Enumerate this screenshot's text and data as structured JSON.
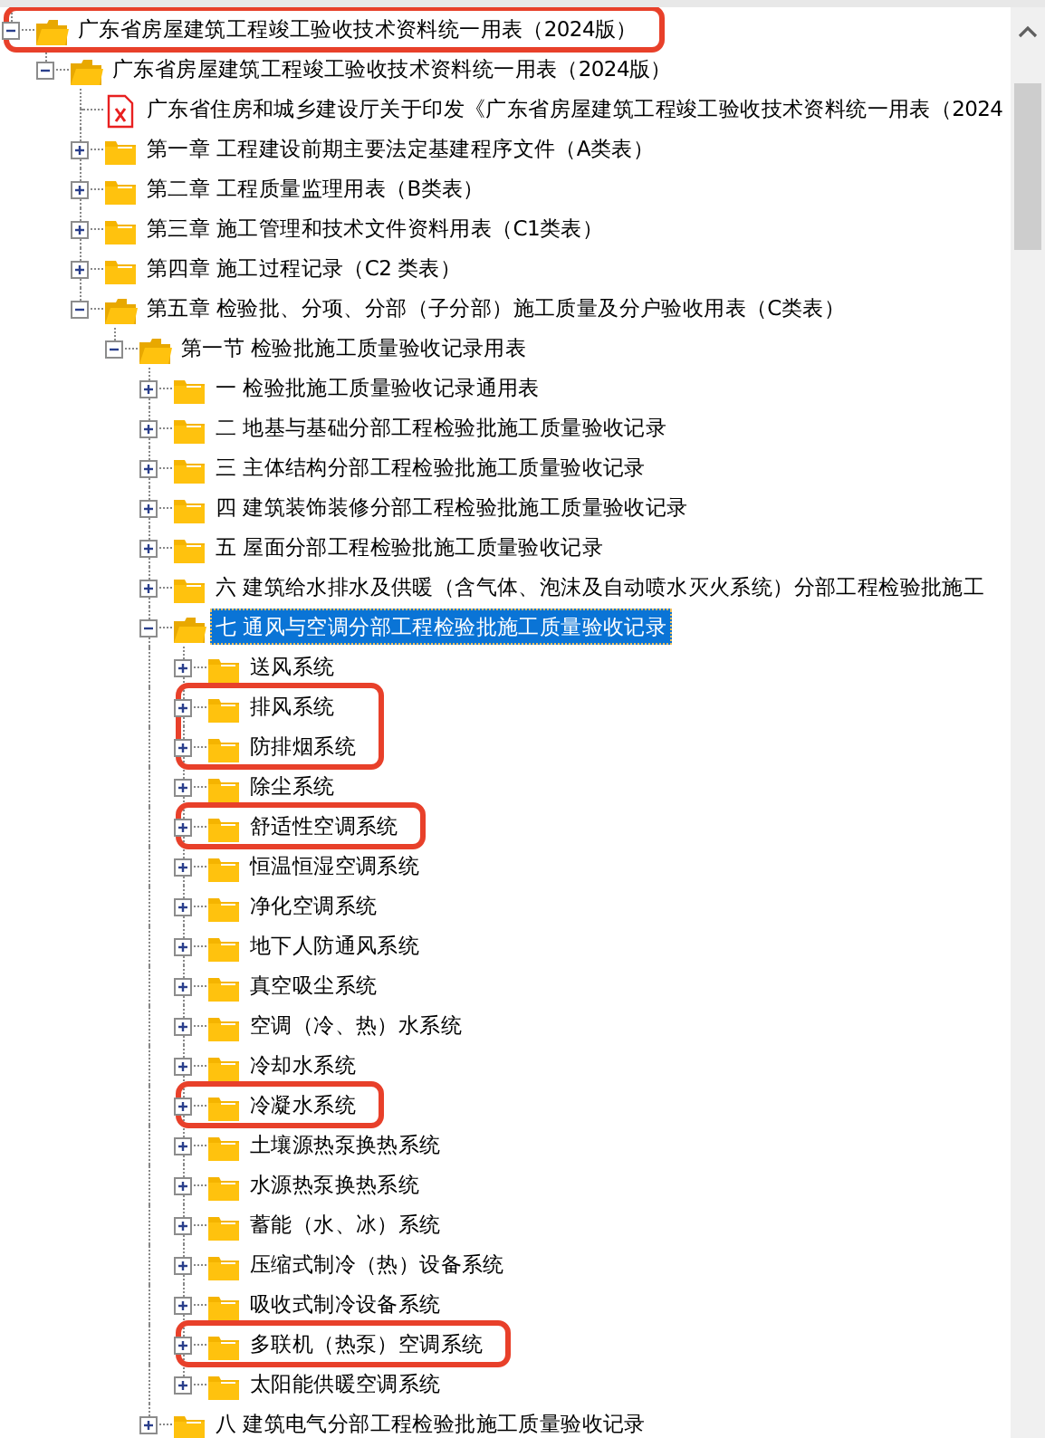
{
  "tree": [
    {
      "label": "广东省房屋建筑工程竣工验收技术资料统一用表（2024版）",
      "kind": "folder",
      "expanded": true,
      "selected": false,
      "marked": true,
      "children": [
        {
          "label": "广东省房屋建筑工程竣工验收技术资料统一用表（2024版）",
          "kind": "folder",
          "expanded": true,
          "selected": false,
          "marked": false,
          "children": [
            {
              "label": "广东省住房和城乡建设厅关于印发《广东省房屋建筑工程竣工验收技术资料统一用表（2024",
              "kind": "pdf",
              "selected": false,
              "marked": false
            },
            {
              "label": "第一章 工程建设前期主要法定基建程序文件（A类表）",
              "kind": "folder",
              "expanded": false,
              "selected": false,
              "marked": false
            },
            {
              "label": "第二章 工程质量监理用表（B类表）",
              "kind": "folder",
              "expanded": false,
              "selected": false,
              "marked": false
            },
            {
              "label": "第三章 施工管理和技术文件资料用表（C1类表）",
              "kind": "folder",
              "expanded": false,
              "selected": false,
              "marked": false
            },
            {
              "label": "第四章 施工过程记录（C2 类表）",
              "kind": "folder",
              "expanded": false,
              "selected": false,
              "marked": false
            },
            {
              "label": "第五章 检验批、分项、分部（子分部）施工质量及分户验收用表（C类表）",
              "kind": "folder",
              "expanded": true,
              "selected": false,
              "marked": false,
              "children": [
                {
                  "label": "第一节 检验批施工质量验收记录用表",
                  "kind": "folder",
                  "expanded": true,
                  "selected": false,
                  "marked": false,
                  "children": [
                    {
                      "label": "一 检验批施工质量验收记录通用表",
                      "kind": "folder",
                      "expanded": false,
                      "selected": false,
                      "marked": false
                    },
                    {
                      "label": "二 地基与基础分部工程检验批施工质量验收记录",
                      "kind": "folder",
                      "expanded": false,
                      "selected": false,
                      "marked": false
                    },
                    {
                      "label": "三 主体结构分部工程检验批施工质量验收记录",
                      "kind": "folder",
                      "expanded": false,
                      "selected": false,
                      "marked": false
                    },
                    {
                      "label": "四 建筑装饰装修分部工程检验批施工质量验收记录",
                      "kind": "folder",
                      "expanded": false,
                      "selected": false,
                      "marked": false
                    },
                    {
                      "label": "五 屋面分部工程检验批施工质量验收记录",
                      "kind": "folder",
                      "expanded": false,
                      "selected": false,
                      "marked": false
                    },
                    {
                      "label": "六 建筑给水排水及供暖（含气体、泡沫及自动喷水灭火系统）分部工程检验批施工",
                      "kind": "folder",
                      "expanded": false,
                      "selected": false,
                      "marked": false
                    },
                    {
                      "label": "七 通风与空调分部工程检验批施工质量验收记录",
                      "kind": "folder",
                      "expanded": true,
                      "selected": true,
                      "marked": false,
                      "children": [
                        {
                          "label": "送风系统",
                          "kind": "folder",
                          "expanded": false,
                          "selected": false,
                          "marked": false
                        },
                        {
                          "label": "排风系统",
                          "kind": "folder",
                          "expanded": false,
                          "selected": false,
                          "marked": true
                        },
                        {
                          "label": "防排烟系统",
                          "kind": "folder",
                          "expanded": false,
                          "selected": false,
                          "marked": true
                        },
                        {
                          "label": "除尘系统",
                          "kind": "folder",
                          "expanded": false,
                          "selected": false,
                          "marked": false
                        },
                        {
                          "label": "舒适性空调系统",
                          "kind": "folder",
                          "expanded": false,
                          "selected": false,
                          "marked": true
                        },
                        {
                          "label": "恒温恒湿空调系统",
                          "kind": "folder",
                          "expanded": false,
                          "selected": false,
                          "marked": false
                        },
                        {
                          "label": "净化空调系统",
                          "kind": "folder",
                          "expanded": false,
                          "selected": false,
                          "marked": false
                        },
                        {
                          "label": "地下人防通风系统",
                          "kind": "folder",
                          "expanded": false,
                          "selected": false,
                          "marked": false
                        },
                        {
                          "label": "真空吸尘系统",
                          "kind": "folder",
                          "expanded": false,
                          "selected": false,
                          "marked": false
                        },
                        {
                          "label": "空调（冷、热）水系统",
                          "kind": "folder",
                          "expanded": false,
                          "selected": false,
                          "marked": false
                        },
                        {
                          "label": "冷却水系统",
                          "kind": "folder",
                          "expanded": false,
                          "selected": false,
                          "marked": false
                        },
                        {
                          "label": "冷凝水系统",
                          "kind": "folder",
                          "expanded": false,
                          "selected": false,
                          "marked": true
                        },
                        {
                          "label": "土壤源热泵换热系统",
                          "kind": "folder",
                          "expanded": false,
                          "selected": false,
                          "marked": false
                        },
                        {
                          "label": "水源热泵换热系统",
                          "kind": "folder",
                          "expanded": false,
                          "selected": false,
                          "marked": false
                        },
                        {
                          "label": "蓄能（水、冰）系统",
                          "kind": "folder",
                          "expanded": false,
                          "selected": false,
                          "marked": false
                        },
                        {
                          "label": "压缩式制冷（热）设备系统",
                          "kind": "folder",
                          "expanded": false,
                          "selected": false,
                          "marked": false
                        },
                        {
                          "label": "吸收式制冷设备系统",
                          "kind": "folder",
                          "expanded": false,
                          "selected": false,
                          "marked": false
                        },
                        {
                          "label": "多联机（热泵）空调系统",
                          "kind": "folder",
                          "expanded": false,
                          "selected": false,
                          "marked": true
                        },
                        {
                          "label": "太阳能供暖空调系统",
                          "kind": "folder",
                          "expanded": false,
                          "selected": false,
                          "marked": false
                        }
                      ]
                    },
                    {
                      "label": "八 建筑电气分部工程检验批施工质量验收记录",
                      "kind": "folder",
                      "expanded": false,
                      "selected": false,
                      "marked": false
                    }
                  ]
                }
              ]
            }
          ]
        }
      ]
    }
  ]
}
